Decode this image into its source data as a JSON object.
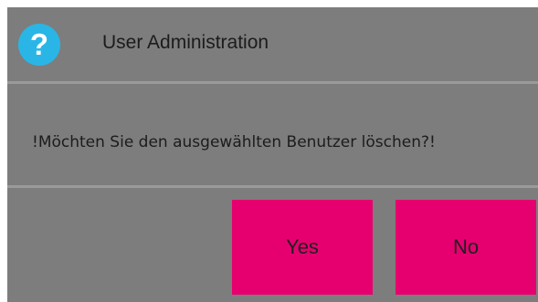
{
  "dialog": {
    "title": "User Administration",
    "icon": "help-icon",
    "message": "!Möchten Sie den ausgewählten Benutzer löschen?!",
    "buttons": {
      "yes_label": "Yes",
      "no_label": "No"
    }
  },
  "colors": {
    "background": "#7d7d7d",
    "divider": "#9a9a9a",
    "accent": "#e6006f",
    "icon": "#29b6e6"
  }
}
